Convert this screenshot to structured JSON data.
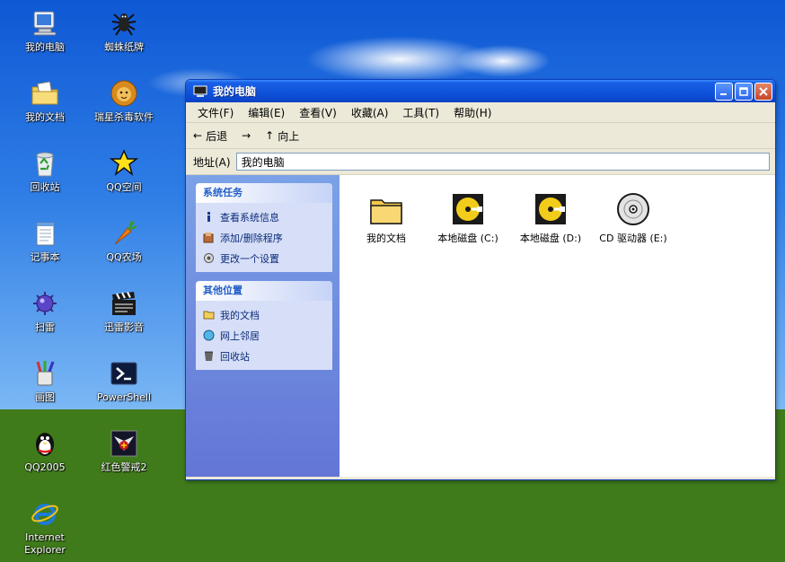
{
  "desktop": {
    "icons": [
      {
        "name": "my-computer",
        "label": "我的电脑",
        "icon": "computer-icon"
      },
      {
        "name": "spider-solitaire",
        "label": "蜘蛛纸牌",
        "icon": "spider-icon"
      },
      {
        "name": "my-documents",
        "label": "我的文档",
        "icon": "documents-folder-icon"
      },
      {
        "name": "rising-antivirus",
        "label": "瑞星杀毒软件",
        "icon": "lion-icon"
      },
      {
        "name": "recycle-bin",
        "label": "回收站",
        "icon": "recycle-bin-icon"
      },
      {
        "name": "qq-space",
        "label": "QQ空间",
        "icon": "star-icon"
      },
      {
        "name": "notepad",
        "label": "记事本",
        "icon": "notepad-icon"
      },
      {
        "name": "qq-farm",
        "label": "QQ农场",
        "icon": "carrot-icon"
      },
      {
        "name": "minesweeper",
        "label": "扫雷",
        "icon": "mine-icon"
      },
      {
        "name": "thunder-player",
        "label": "迅雷影音",
        "icon": "clapperboard-icon"
      },
      {
        "name": "paint",
        "label": "画图",
        "icon": "paint-icon"
      },
      {
        "name": "powershell",
        "label": "PowerShell",
        "icon": "powershell-icon"
      },
      {
        "name": "qq2005",
        "label": "QQ2005",
        "icon": "penguin-icon"
      },
      {
        "name": "red-alert-2",
        "label": "红色警戒2",
        "icon": "red-alert-icon"
      },
      {
        "name": "internet-explorer",
        "label": "Internet Explorer",
        "icon": "ie-icon"
      }
    ]
  },
  "window": {
    "title": "我的电脑",
    "menu": [
      "文件(F)",
      "编辑(E)",
      "查看(V)",
      "收藏(A)",
      "工具(T)",
      "帮助(H)"
    ],
    "toolbar": {
      "back": "后退",
      "up": "向上"
    },
    "address": {
      "label": "地址(A)",
      "value": "我的电脑"
    },
    "system_tasks": {
      "title": "系统任务",
      "items": [
        "查看系统信息",
        "添加/删除程序",
        "更改一个设置"
      ]
    },
    "other_places": {
      "title": "其他位置",
      "items": [
        "我的文档",
        "网上邻居",
        "回收站"
      ]
    },
    "drives": [
      {
        "label": "我的文档",
        "icon": "folder-icon"
      },
      {
        "label": "本地磁盘 (C:)",
        "icon": "hard-disk-icon"
      },
      {
        "label": "本地磁盘 (D:)",
        "icon": "hard-disk-icon"
      },
      {
        "label": "CD 驱动器 (E:)",
        "icon": "cd-drive-icon"
      }
    ]
  }
}
